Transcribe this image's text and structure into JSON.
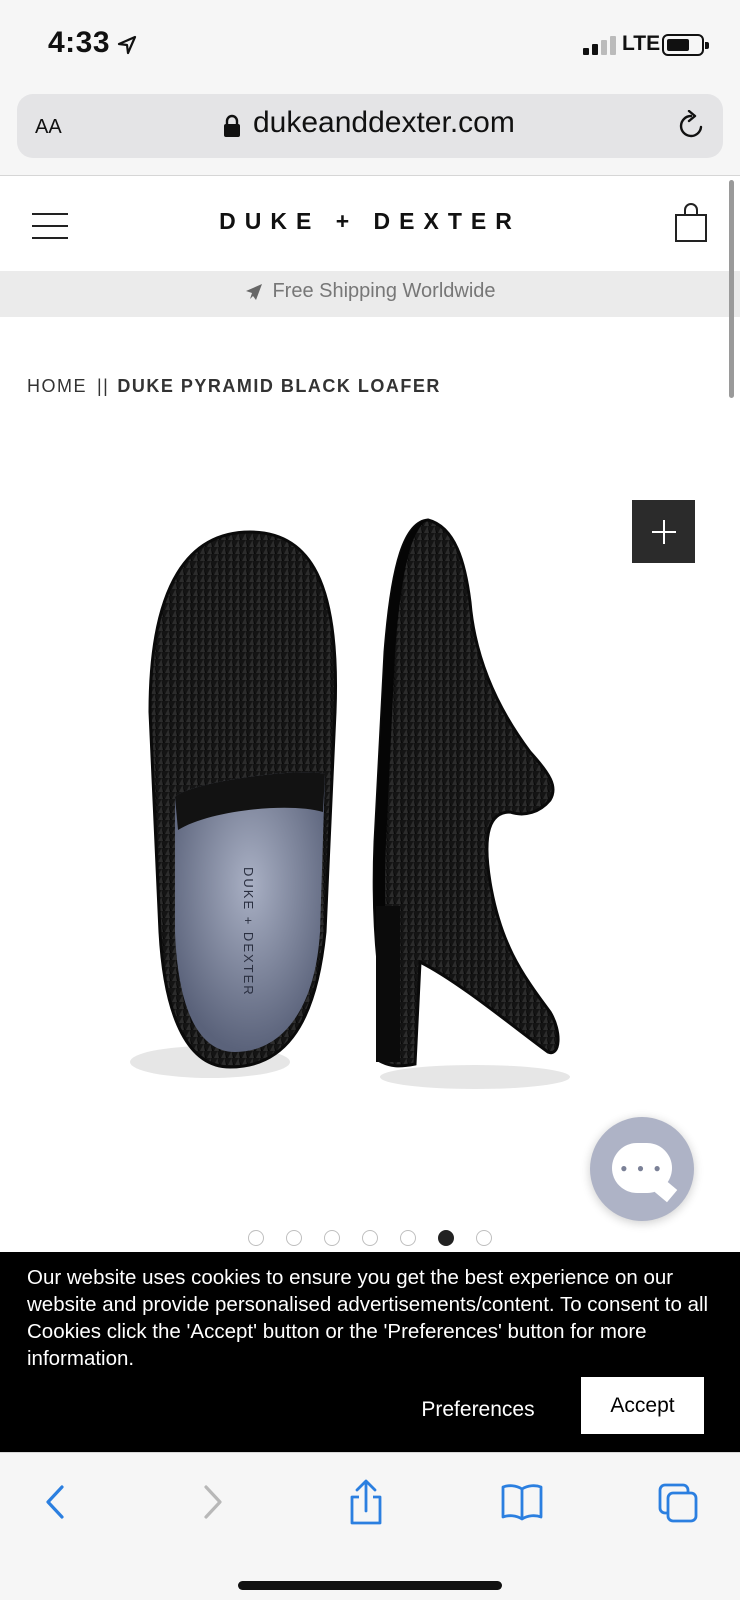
{
  "status_bar": {
    "time": "4:33",
    "network": "LTE"
  },
  "browser": {
    "text_size_label": "AA",
    "url": "dukeanddexter.com"
  },
  "site": {
    "brand": "DUKE + DEXTER",
    "shipping_banner": "Free Shipping Worldwide"
  },
  "breadcrumb": {
    "home": "HOME",
    "separator": "||",
    "current": "DUKE PYRAMID BLACK LOAFER"
  },
  "product": {
    "insole_brand": "DUKE + DEXTER",
    "carousel": {
      "total": 7,
      "active_index": 5
    }
  },
  "cookie_banner": {
    "message": "Our website uses cookies to ensure you get the best experience on our website and provide personalised advertisements/content. To consent to all Cookies click the 'Accept' button or the 'Preferences' button for more information.",
    "preferences_label": "Preferences",
    "accept_label": "Accept"
  },
  "colors": {
    "accent": "#2b7fe0",
    "banner_bg": "#000000",
    "zoom_bg": "#2b2b2b",
    "chat_bg": "#aeb3c6"
  },
  "icons": [
    "location-arrow-icon",
    "lock-icon",
    "reload-icon",
    "hamburger-menu-icon",
    "shopping-bag-icon",
    "airplane-icon",
    "zoom-plus-icon",
    "chat-icon",
    "back-arrow-icon",
    "forward-arrow-icon",
    "share-icon",
    "bookmarks-icon",
    "tabs-icon"
  ]
}
